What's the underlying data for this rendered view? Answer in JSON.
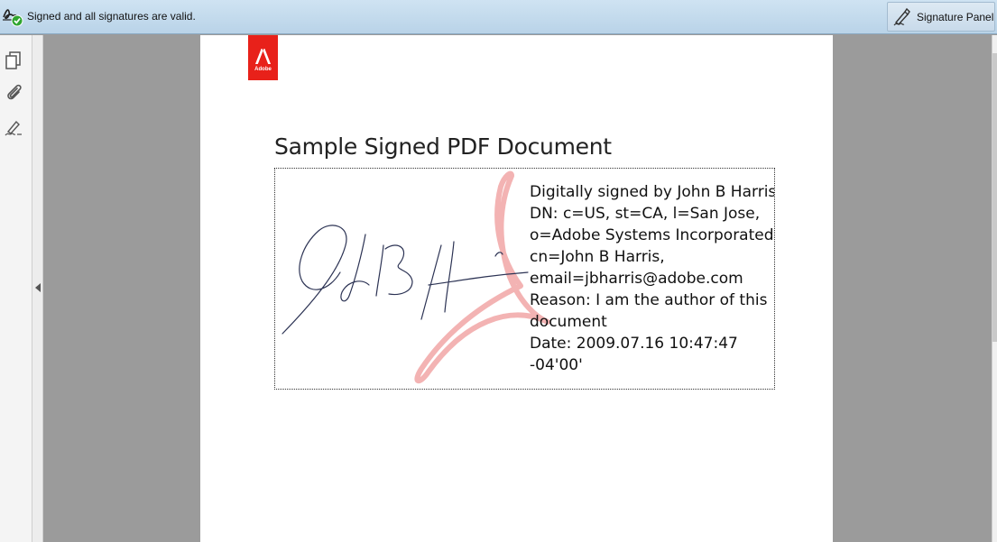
{
  "signature_bar": {
    "status_text": "Signed and all signatures are valid.",
    "status_icon": "signature-valid-icon",
    "panel_button_label": "Signature Panel",
    "panel_button_icon": "signature-pen-icon"
  },
  "left_nav": {
    "icons": [
      "pages-icon",
      "attachments-icon",
      "signatures-icon"
    ]
  },
  "document": {
    "logo_text": "Adobe",
    "title": "Sample Signed PDF Document",
    "signature_lines": [
      "Digitally signed by John B Harris",
      "DN: c=US, st=CA, l=San Jose,",
      "o=Adobe Systems Incorporated,",
      "cn=John B Harris,",
      "email=jbharris@adobe.com",
      "Reason: I am the author of this",
      "document",
      "Date: 2009.07.16 10:47:47",
      "-04'00'"
    ]
  },
  "colors": {
    "adobe_red": "#e8211a",
    "valid_green": "#2fa52f",
    "toolbar_blue": "#c4dbee",
    "viewer_gray": "#9b9b9b"
  }
}
